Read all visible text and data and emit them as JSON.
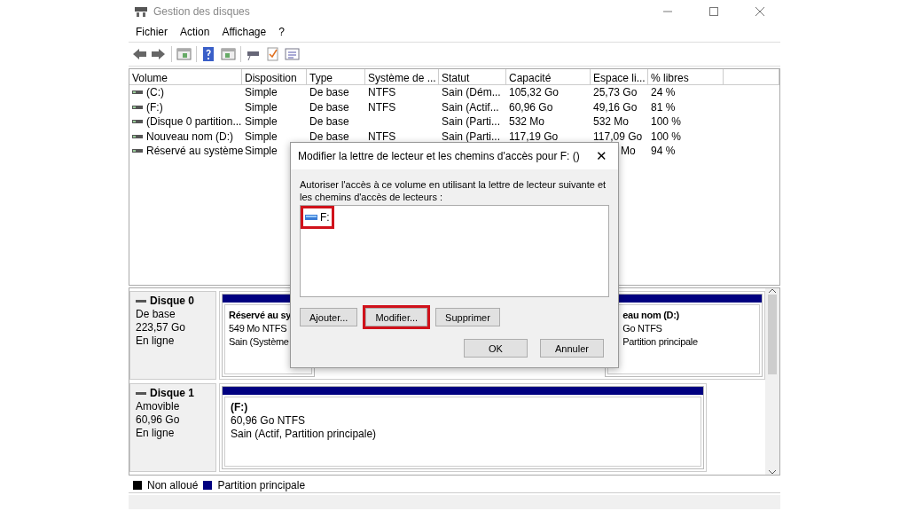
{
  "window": {
    "title": "Gestion des disques"
  },
  "menu": [
    {
      "label": "Fichier"
    },
    {
      "label": "Action"
    },
    {
      "label": "Affichage"
    },
    {
      "label": "?"
    }
  ],
  "table": {
    "columns": [
      "Volume",
      "Disposition",
      "Type",
      "Système de ...",
      "Statut",
      "Capacité",
      "Espace li...",
      "% libres"
    ],
    "rows": [
      {
        "cells": [
          "(C:)",
          "Simple",
          "De base",
          "NTFS",
          "Sain (Dém...",
          "105,32 Go",
          "25,73 Go",
          "24 %"
        ]
      },
      {
        "cells": [
          "(F:)",
          "Simple",
          "De base",
          "NTFS",
          "Sain (Actif...",
          "60,96 Go",
          "49,16 Go",
          "81 %"
        ]
      },
      {
        "cells": [
          "(Disque 0 partition...",
          "Simple",
          "De base",
          null,
          "Sain (Parti...",
          "532 Mo",
          "532 Mo",
          "100 %"
        ]
      },
      {
        "cells": [
          "Nouveau nom (D:)",
          "Simple",
          "De base",
          "NTFS",
          "Sain (Parti...",
          "117,19 Go",
          "117,09 Go",
          "100 %"
        ]
      },
      {
        "cells": [
          "Réservé au système",
          "Simple",
          null,
          null,
          null,
          null,
          "Mo",
          "94 %"
        ]
      }
    ]
  },
  "disks": [
    {
      "name": "Disque 0",
      "lines": [
        "De base",
        "223,57 Go",
        "En ligne"
      ],
      "partitions": [
        {
          "lines": [
            "Réservé au sy",
            "549 Mo NTFS",
            "Sain (Système"
          ]
        },
        {
          "lines": [
            "eau nom  (D:)",
            "Go NTFS",
            "Partition principale"
          ]
        }
      ]
    },
    {
      "name": "Disque 1",
      "lines": [
        "Amovible",
        "60,96 Go",
        "En ligne"
      ],
      "partitions": [
        {
          "lines": [
            "(F:)",
            "60,96 Go NTFS",
            "Sain (Actif, Partition principale)"
          ]
        }
      ]
    }
  ],
  "legend": [
    {
      "label": "Non alloué",
      "color": "#000000"
    },
    {
      "label": "Partition principale",
      "color": "#000080"
    }
  ],
  "dialog": {
    "title": "Modifier la lettre de lecteur et les chemins d'accès pour F: ()",
    "close": "✕",
    "instructions": "Autoriser l'accès à ce volume en utilisant la lettre de lecteur suivante et les chemins d'accès de lecteurs :",
    "paths": [
      {
        "label": "F:",
        "highlighted": true
      }
    ],
    "buttons": [
      {
        "label": "Ajouter...",
        "highlighted": false
      },
      {
        "label": "Modifier...",
        "highlighted": true
      },
      {
        "label": "Supprimer",
        "highlighted": false
      }
    ],
    "footer_buttons": [
      {
        "label": "OK"
      },
      {
        "label": "Annuler"
      }
    ]
  }
}
